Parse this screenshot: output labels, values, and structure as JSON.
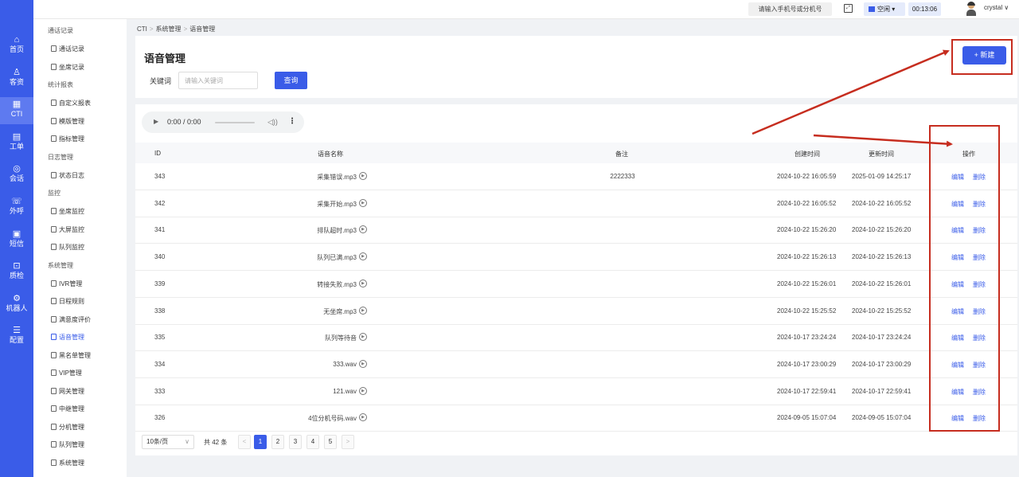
{
  "rail": {
    "items": [
      {
        "icon": "⌂",
        "label": "首页",
        "active": false
      },
      {
        "icon": "♙",
        "label": "客资",
        "active": false
      },
      {
        "icon": "▦",
        "label": "CTI",
        "active": true
      },
      {
        "icon": "▤",
        "label": "工单",
        "active": false
      },
      {
        "icon": "◎",
        "label": "会话",
        "active": false
      },
      {
        "icon": "☏",
        "label": "外呼",
        "active": false
      },
      {
        "icon": "▣",
        "label": "短信",
        "active": false
      },
      {
        "icon": "⊡",
        "label": "质检",
        "active": false
      },
      {
        "icon": "⚙",
        "label": "机器人",
        "active": false
      },
      {
        "icon": "☰",
        "label": "配置",
        "active": false
      }
    ]
  },
  "submenu": {
    "groups": [
      {
        "label": "通话记录",
        "items": [
          {
            "label": "通话记录",
            "active": false
          },
          {
            "label": "坐席记录",
            "active": false
          }
        ]
      },
      {
        "label": "统计报表",
        "items": [
          {
            "label": "自定义报表",
            "active": false
          },
          {
            "label": "模版管理",
            "active": false
          },
          {
            "label": "指标管理",
            "active": false
          }
        ]
      },
      {
        "label": "日志管理",
        "items": [
          {
            "label": "状态日志",
            "active": false
          }
        ]
      },
      {
        "label": "监控",
        "items": [
          {
            "label": "坐席监控",
            "active": false
          },
          {
            "label": "大屏监控",
            "active": false
          },
          {
            "label": "队列监控",
            "active": false
          }
        ]
      },
      {
        "label": "系统管理",
        "items": [
          {
            "label": "IVR管理",
            "active": false
          },
          {
            "label": "日程规则",
            "active": false
          },
          {
            "label": "满意度评价",
            "active": false
          },
          {
            "label": "语音管理",
            "active": true
          },
          {
            "label": "黑名单管理",
            "active": false
          },
          {
            "label": "VIP管理",
            "active": false
          },
          {
            "label": "网关管理",
            "active": false
          },
          {
            "label": "中继管理",
            "active": false
          },
          {
            "label": "分机管理",
            "active": false
          },
          {
            "label": "队列管理",
            "active": false
          },
          {
            "label": "系统管理",
            "active": false
          }
        ]
      }
    ]
  },
  "topbar": {
    "search_text": "请输入手机号或分机号",
    "status": "空闲 ▾",
    "timer": "00:13:06",
    "username": "crystal ∨"
  },
  "breadcrumb": [
    "CTI",
    "系统管理",
    "语音管理"
  ],
  "page": {
    "title": "语音管理",
    "keyword_label": "关键词",
    "keyword_placeholder": "请输入关键词",
    "query_label": "查询",
    "new_label": "+ 新建"
  },
  "audio": {
    "time": "0:00 / 0:00"
  },
  "table": {
    "headers": {
      "id": "ID",
      "name": "语音名称",
      "remark": "备注",
      "created": "创建时间",
      "updated": "更新时间",
      "actions": "操作"
    },
    "edit_label": "编辑",
    "delete_label": "删除",
    "rows": [
      {
        "id": "343",
        "name": "采集错误.mp3",
        "remark": "2222333",
        "created": "2024-10-22 16:05:59",
        "updated": "2025-01-09 14:25:17"
      },
      {
        "id": "342",
        "name": "采集开始.mp3",
        "remark": "",
        "created": "2024-10-22 16:05:52",
        "updated": "2024-10-22 16:05:52"
      },
      {
        "id": "341",
        "name": "排队超时.mp3",
        "remark": "",
        "created": "2024-10-22 15:26:20",
        "updated": "2024-10-22 15:26:20"
      },
      {
        "id": "340",
        "name": "队列已满.mp3",
        "remark": "",
        "created": "2024-10-22 15:26:13",
        "updated": "2024-10-22 15:26:13"
      },
      {
        "id": "339",
        "name": "转接失败.mp3",
        "remark": "",
        "created": "2024-10-22 15:26:01",
        "updated": "2024-10-22 15:26:01"
      },
      {
        "id": "338",
        "name": "无坐席.mp3",
        "remark": "",
        "created": "2024-10-22 15:25:52",
        "updated": "2024-10-22 15:25:52"
      },
      {
        "id": "335",
        "name": "队列等待音",
        "remark": "",
        "created": "2024-10-17 23:24:24",
        "updated": "2024-10-17 23:24:24"
      },
      {
        "id": "334",
        "name": "333.wav",
        "remark": "",
        "created": "2024-10-17 23:00:29",
        "updated": "2024-10-17 23:00:29"
      },
      {
        "id": "333",
        "name": "121.wav",
        "remark": "",
        "created": "2024-10-17 22:59:41",
        "updated": "2024-10-17 22:59:41"
      },
      {
        "id": "326",
        "name": "4位分机号码.wav",
        "remark": "",
        "created": "2024-09-05 15:07:04",
        "updated": "2024-09-05 15:07:04"
      }
    ]
  },
  "pagination": {
    "page_size": "10条/页",
    "total": "共 42 条",
    "prev": "<",
    "next": ">",
    "pages": [
      "1",
      "2",
      "3",
      "4",
      "5"
    ],
    "current": "1"
  },
  "annotation_color": "#c62d1f",
  "accent_color": "#3a5ce8"
}
